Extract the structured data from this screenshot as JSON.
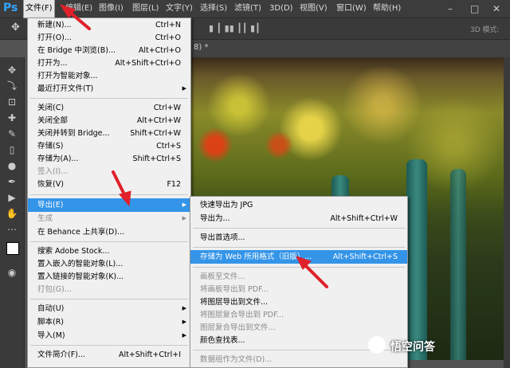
{
  "app": {
    "logo": "Ps"
  },
  "menubar": {
    "items": [
      "文件(F)",
      "编辑(E)",
      "图像(I)",
      "图层(L)",
      "文字(Y)",
      "选择(S)",
      "滤镜(T)",
      "3D(D)",
      "视图(V)",
      "窗口(W)",
      "帮助(H)"
    ],
    "active": "文件(F)"
  },
  "options_bar": {
    "mode_label": "3D 模式:"
  },
  "document_tab": {
    "title_fragment": "8) * "
  },
  "file_menu": {
    "items": [
      {
        "label": "新建(N)...",
        "shortcut": "Ctrl+N"
      },
      {
        "label": "打开(O)...",
        "shortcut": "Ctrl+O"
      },
      {
        "label": "在 Bridge 中浏览(B)...",
        "shortcut": "Alt+Ctrl+O"
      },
      {
        "label": "打开为...",
        "shortcut": "Alt+Shift+Ctrl+O"
      },
      {
        "label": "打开为智能对象...",
        "shortcut": ""
      },
      {
        "label": "最近打开文件(T)",
        "shortcut": "",
        "submenu": true
      },
      {
        "label": "关闭(C)",
        "shortcut": "Ctrl+W"
      },
      {
        "label": "关闭全部",
        "shortcut": "Alt+Ctrl+W"
      },
      {
        "label": "关闭并转到 Bridge...",
        "shortcut": "Shift+Ctrl+W"
      },
      {
        "label": "存储(S)",
        "shortcut": "Ctrl+S"
      },
      {
        "label": "存储为(A)...",
        "shortcut": "Shift+Ctrl+S"
      },
      {
        "label": "签入(I)...",
        "shortcut": "",
        "disabled": true
      },
      {
        "label": "恢复(V)",
        "shortcut": "F12"
      },
      {
        "label": "导出(E)",
        "shortcut": "",
        "submenu": true,
        "highlighted": true
      },
      {
        "label": "生成",
        "shortcut": "",
        "submenu": true,
        "disabled": true
      },
      {
        "label": "在 Behance 上共享(D)...",
        "shortcut": ""
      },
      {
        "label": "搜索 Adobe Stock...",
        "shortcut": ""
      },
      {
        "label": "置入嵌入的智能对象(L)...",
        "shortcut": ""
      },
      {
        "label": "置入链接的智能对象(K)...",
        "shortcut": ""
      },
      {
        "label": "打包(G)...",
        "shortcut": "",
        "disabled": true
      },
      {
        "label": "自动(U)",
        "shortcut": "",
        "submenu": true
      },
      {
        "label": "脚本(R)",
        "shortcut": "",
        "submenu": true
      },
      {
        "label": "导入(M)",
        "shortcut": "",
        "submenu": true
      },
      {
        "label": "文件简介(F)...",
        "shortcut": "Alt+Shift+Ctrl+I"
      }
    ]
  },
  "export_submenu": {
    "items": [
      {
        "label": "快速导出为 JPG",
        "shortcut": ""
      },
      {
        "label": "导出为...",
        "shortcut": "Alt+Shift+Ctrl+W"
      },
      {
        "label": "导出首选项...",
        "shortcut": ""
      },
      {
        "label": "存储为 Web 所用格式（旧版）...",
        "shortcut": "Alt+Shift+Ctrl+S",
        "highlighted": true
      },
      {
        "label": "画板至文件...",
        "shortcut": "",
        "disabled": true
      },
      {
        "label": "将画板导出到 PDF...",
        "shortcut": "",
        "disabled": true
      },
      {
        "label": "将图层导出到文件...",
        "shortcut": ""
      },
      {
        "label": "将图层复合导出到 PDF...",
        "shortcut": "",
        "disabled": true
      },
      {
        "label": "图层复合导出到文件...",
        "shortcut": "",
        "disabled": true
      },
      {
        "label": "颜色查找表...",
        "shortcut": ""
      },
      {
        "label": "数据组作为文件(D)...",
        "shortcut": "",
        "disabled": true
      }
    ]
  },
  "watermark": {
    "text": "悟空问答"
  },
  "colors": {
    "highlight": "#3394e8",
    "annotation": "#e0202a"
  }
}
